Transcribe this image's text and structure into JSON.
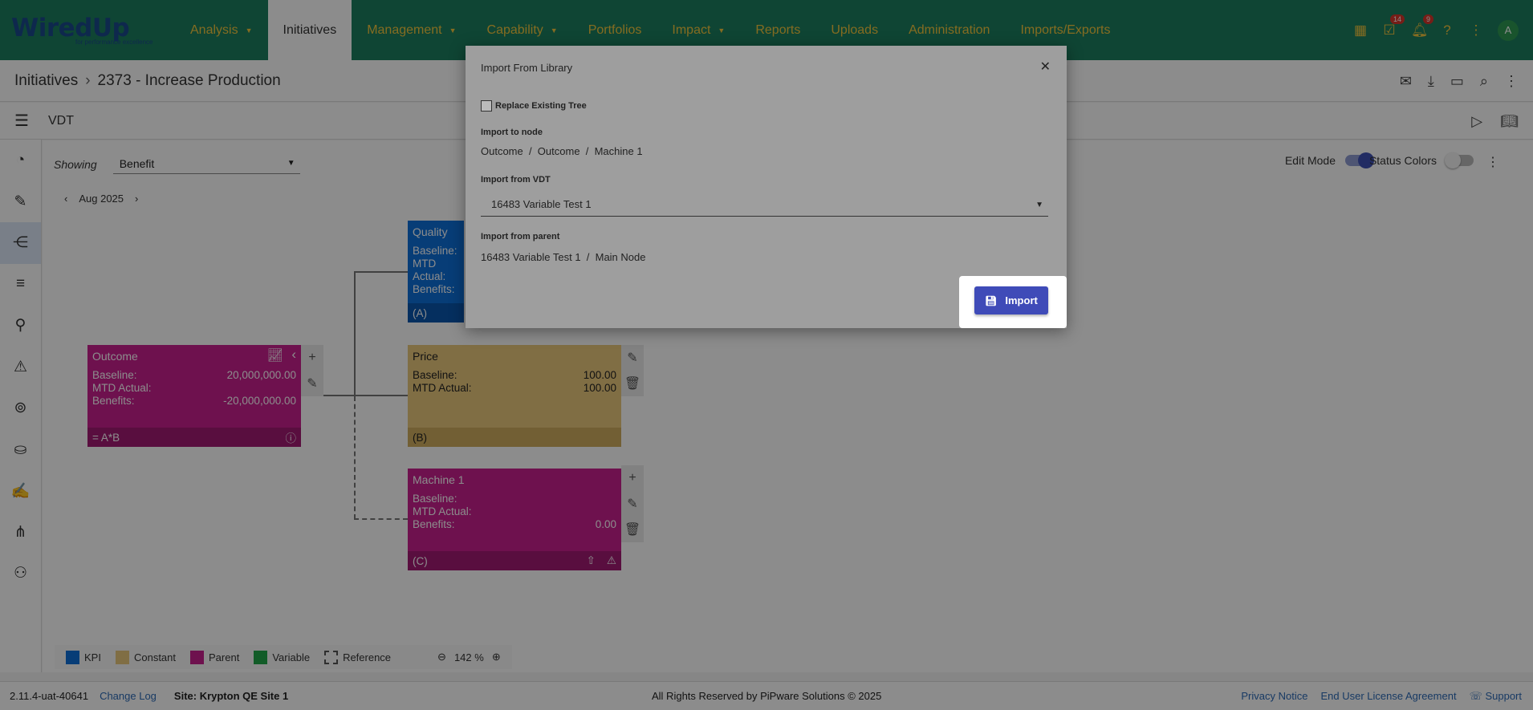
{
  "brand": {
    "name": "WiredUp",
    "tagline": "for performance excellence"
  },
  "nav": {
    "items": [
      {
        "label": "Analysis",
        "caret": "▼"
      },
      {
        "label": "Initiatives",
        "caret": ""
      },
      {
        "label": "Management",
        "caret": "▼"
      },
      {
        "label": "Capability",
        "caret": "▼"
      },
      {
        "label": "Portfolios",
        "caret": ""
      },
      {
        "label": "Impact",
        "caret": "▼"
      },
      {
        "label": "Reports",
        "caret": ""
      },
      {
        "label": "Uploads",
        "caret": ""
      },
      {
        "label": "Administration",
        "caret": ""
      },
      {
        "label": "Imports/Exports",
        "caret": ""
      }
    ],
    "active": "Initiatives",
    "task_badge": "14",
    "notification_badge": "9",
    "avatar": "A"
  },
  "breadcrumb": {
    "root": "Initiatives",
    "current": "2373 - Increase Production"
  },
  "vdt": {
    "title": "VDT"
  },
  "toolbar": {
    "showing_label": "Showing",
    "showing_value": "Benefit",
    "date": "Aug 2025",
    "edit_mode_label": "Edit Mode",
    "status_colors_label": "Status Colors"
  },
  "nodes": {
    "quality": {
      "title": "Quality",
      "baseline_label": "Baseline:",
      "mtd_label": "MTD Actual:",
      "benefits_label": "Benefits:",
      "tag": "(A)"
    },
    "outcome": {
      "title": "Outcome",
      "baseline_label": "Baseline:",
      "baseline": "20,000,000.00",
      "mtd_label": "MTD Actual:",
      "benefits_label": "Benefits:",
      "benefits": "-20,000,000.00",
      "formula": "= A*B"
    },
    "price": {
      "title": "Price",
      "baseline_label": "Baseline:",
      "baseline": "100.00",
      "mtd_label": "MTD Actual:",
      "mtd": "100.00",
      "tag": "(B)"
    },
    "machine1": {
      "title": "Machine 1",
      "baseline_label": "Baseline:",
      "mtd_label": "MTD Actual:",
      "benefits_label": "Benefits:",
      "benefits": "0.00",
      "tag": "(C)"
    }
  },
  "legend": {
    "items": [
      {
        "label": "KPI",
        "color": "#0d6fd9"
      },
      {
        "label": "Constant",
        "color": "#e9c87c"
      },
      {
        "label": "Parent",
        "color": "#c8208f"
      },
      {
        "label": "Variable",
        "color": "#22a84a"
      },
      {
        "label": "Reference",
        "color": ""
      }
    ],
    "zoom": "142 %"
  },
  "footer": {
    "version": "2.11.4-uat-40641",
    "changelog": "Change Log",
    "site": "Site: Krypton QE Site 1",
    "copyright": "All Rights Reserved by PiPware Solutions © 2025",
    "privacy": "Privacy Notice",
    "eula": "End User License Agreement",
    "support": "Support"
  },
  "modal": {
    "title": "Import From Library",
    "replace_label": "Replace Existing Tree",
    "import_to_label": "Import to node",
    "import_to_path": "Outcome  /  Outcome  /  Machine 1",
    "import_from_vdt_label": "Import from VDT",
    "import_from_vdt_value": "16483 Variable Test 1",
    "import_from_parent_label": "Import from parent",
    "import_from_parent_path": "16483 Variable Test 1  /  Main Node",
    "import_button": "Import"
  }
}
